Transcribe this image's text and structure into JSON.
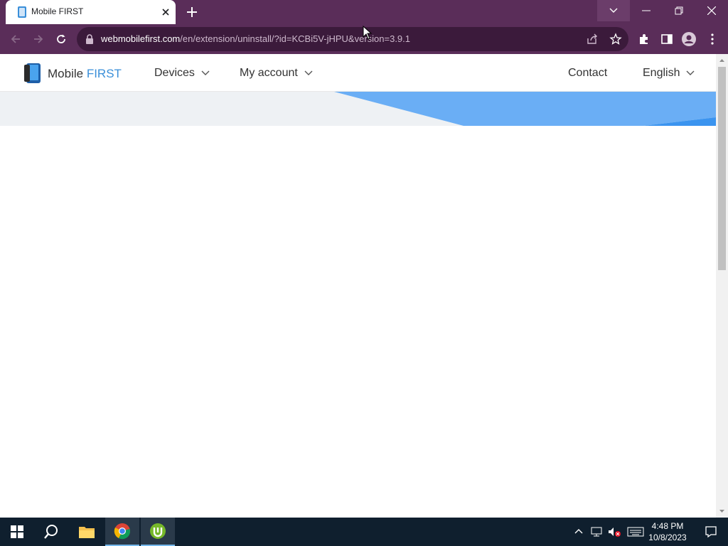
{
  "browser": {
    "tab_title": "Mobile FIRST",
    "url_host": "webmobilefirst.com",
    "url_path": "/en/extension/uninstall/?id=KCBi5V-jHPU&version=3.9.1",
    "theme_color": "#5a2d59"
  },
  "site": {
    "logo_text_primary": "Mobile",
    "logo_text_accent": "FIRST",
    "accent_color": "#3a8fd9",
    "nav": {
      "devices": "Devices",
      "my_account": "My account",
      "contact": "Contact",
      "language": "English"
    },
    "hero_accent_color": "#6aaef5"
  },
  "taskbar": {
    "time": "4:48 PM",
    "date": "10/8/2023",
    "icons": [
      "windows-start-icon",
      "search-icon",
      "file-explorer-icon",
      "chrome-icon",
      "utorrent-icon"
    ]
  }
}
